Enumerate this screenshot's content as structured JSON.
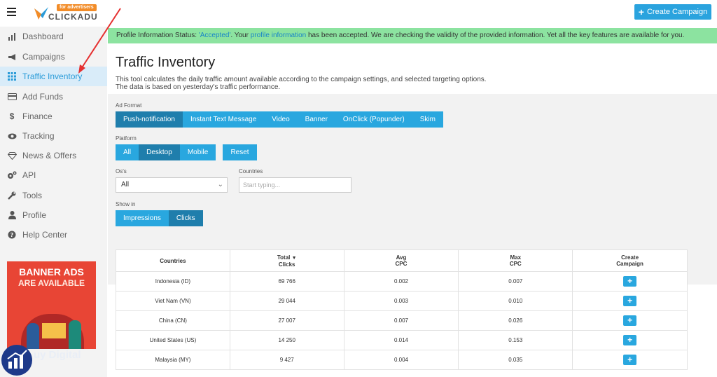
{
  "header": {
    "logo_text": "CLICKADU",
    "logo_tag": "for advertisers",
    "create_campaign": "Create Campaign"
  },
  "sidebar": {
    "items": [
      {
        "label": "Dashboard",
        "icon": "bar-chart-icon"
      },
      {
        "label": "Campaigns",
        "icon": "megaphone-icon"
      },
      {
        "label": "Traffic Inventory",
        "icon": "grid-icon"
      },
      {
        "label": "Add Funds",
        "icon": "credit-card-icon"
      },
      {
        "label": "Finance",
        "icon": "dollar-icon"
      },
      {
        "label": "Tracking",
        "icon": "eye-icon"
      },
      {
        "label": "News & Offers",
        "icon": "diamond-icon"
      },
      {
        "label": "API",
        "icon": "gears-icon"
      },
      {
        "label": "Tools",
        "icon": "wrench-icon"
      },
      {
        "label": "Profile",
        "icon": "user-icon"
      },
      {
        "label": "Help Center",
        "icon": "question-icon"
      }
    ],
    "active_index": 2,
    "banner": {
      "line1": "BANNER ADS",
      "line2": "ARE AVAILABLE"
    },
    "watermark": "uy Digital"
  },
  "notice": {
    "prefix": "Profile Information Status: ",
    "status": "'Accepted'",
    "middle": ". Your ",
    "link": "profile information",
    "suffix": " has been accepted. We are checking the validity of the provided information. Yet all the key features are available for you."
  },
  "main": {
    "title": "Traffic Inventory",
    "desc1": "This tool calculates the daily traffic amount available according to the campaign settings, and selected targeting options.",
    "desc2": "The data is based on yesterday's traffic performance.",
    "ad_format_label": "Ad Format",
    "ad_formats": [
      "Push-notification",
      "Instant Text Message",
      "Video",
      "Banner",
      "OnClick (Popunder)",
      "Skim"
    ],
    "platform_label": "Platform",
    "platforms": [
      "All",
      "Desktop",
      "Mobile"
    ],
    "reset": "Reset",
    "os_label": "Os's",
    "os_value": "All",
    "countries_label": "Countries",
    "countries_placeholder": "Start typing...",
    "show_in_label": "Show in",
    "show_in": [
      "Impressions",
      "Clicks"
    ]
  },
  "table": {
    "headers": [
      {
        "line1": "Countries",
        "line2": ""
      },
      {
        "line1": "Total",
        "line2": "Clicks"
      },
      {
        "line1": "Avg",
        "line2": "CPC"
      },
      {
        "line1": "Max",
        "line2": "CPC"
      },
      {
        "line1": "Create",
        "line2": "Campaign"
      }
    ],
    "rows": [
      {
        "country": "Indonesia (ID)",
        "total": "69 766",
        "avg": "0.002",
        "max": "0.007"
      },
      {
        "country": "Viet Nam (VN)",
        "total": "29 044",
        "avg": "0.003",
        "max": "0.010"
      },
      {
        "country": "China (CN)",
        "total": "27 007",
        "avg": "0.007",
        "max": "0.026"
      },
      {
        "country": "United States (US)",
        "total": "14 250",
        "avg": "0.014",
        "max": "0.153"
      },
      {
        "country": "Malaysia (MY)",
        "total": "9 427",
        "avg": "0.004",
        "max": "0.035"
      }
    ],
    "add_label": "+"
  },
  "colors": {
    "accent": "#29a7df",
    "accent_dark": "#1f7eac",
    "notice": "#8ce3a0",
    "banner": "#e84535"
  }
}
